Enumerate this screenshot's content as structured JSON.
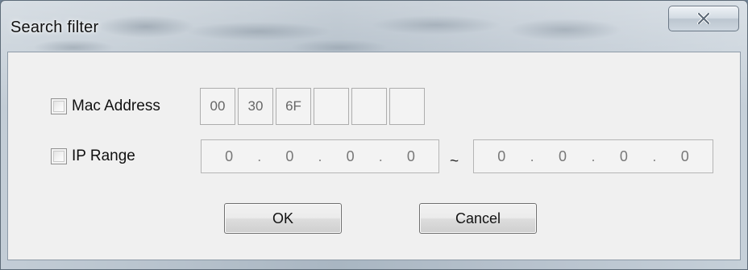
{
  "window": {
    "title": "Search filter"
  },
  "mac_filter": {
    "label": "Mac Address",
    "checked": false,
    "octets": [
      "00",
      "30",
      "6F",
      "",
      "",
      ""
    ]
  },
  "ip_filter": {
    "label": "IP Range",
    "checked": false,
    "separator": "~",
    "start": [
      "0",
      "0",
      "0",
      "0"
    ],
    "end": [
      "0",
      "0",
      "0",
      "0"
    ]
  },
  "buttons": {
    "ok": "OK",
    "cancel": "Cancel"
  },
  "icons": {
    "close": "close-icon"
  },
  "colors": {
    "dialog_background": "#f0f0f0",
    "frame": "#b9c4ce"
  }
}
